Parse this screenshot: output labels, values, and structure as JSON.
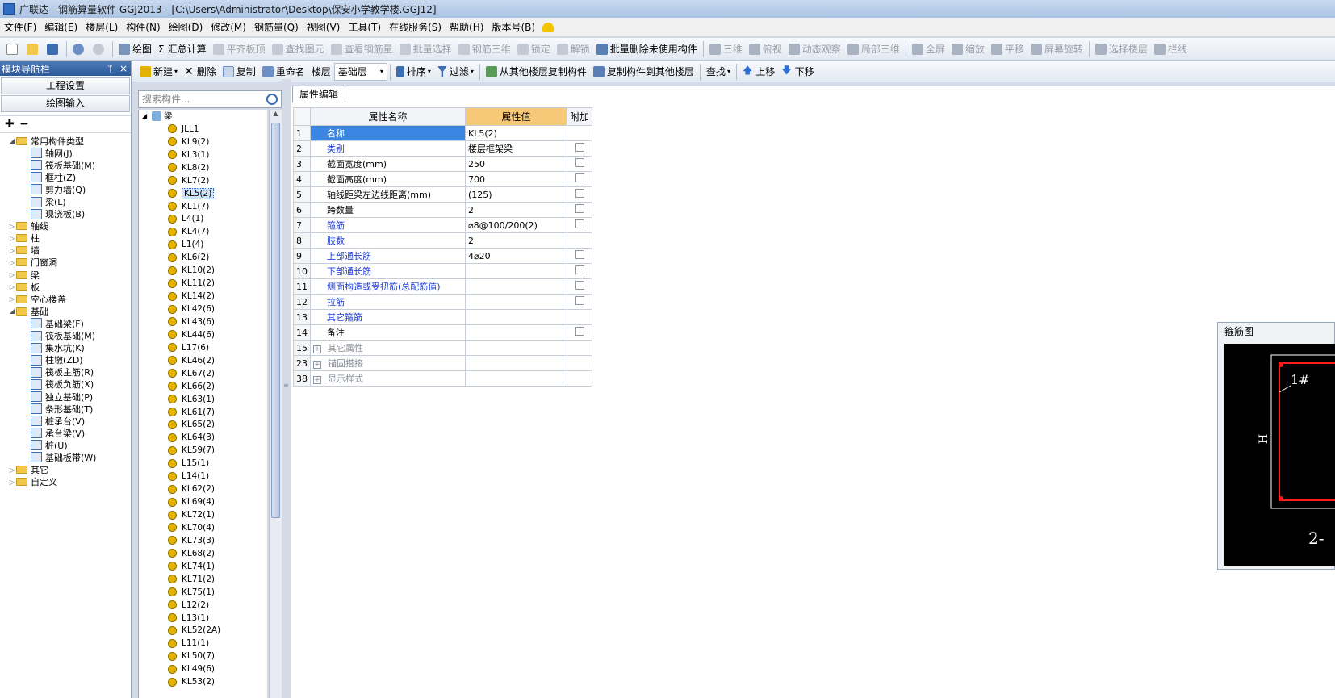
{
  "window": {
    "title": "广联达—钢筋算量软件 GGJ2013 - [C:\\Users\\Administrator\\Desktop\\保安小学教学楼.GGJ12]"
  },
  "menu": [
    "文件(F)",
    "编辑(E)",
    "楼层(L)",
    "构件(N)",
    "绘图(D)",
    "修改(M)",
    "钢筋量(Q)",
    "视图(V)",
    "工具(T)",
    "在线服务(S)",
    "帮助(H)",
    "版本号(B)"
  ],
  "toolbar1": {
    "draw": "绘图",
    "calc": "汇总计算",
    "align_top": "平齐板顶",
    "find_element": "查找图元",
    "view_rebar": "查看钢筋量",
    "batch_select": "批量选择",
    "rebar3d": "钢筋三维",
    "lock": "锁定",
    "unlock": "解锁",
    "batch_delete": "批量删除未使用构件",
    "view3d": "三维",
    "topview": "俯视",
    "dynamic": "动态观察",
    "local3d": "局部三维",
    "fullscreen": "全屏",
    "zoom": "缩放",
    "pan": "平移",
    "rotate": "屏幕旋转",
    "select_floor": "选择楼层",
    "other": "栏线"
  },
  "nav": {
    "title": "模块导航栏",
    "pin": "ᛘ",
    "close": "×",
    "btn_project": "工程设置",
    "btn_draw": "绘图输入"
  },
  "tree": [
    {
      "label": "常用构件类型",
      "level": 0,
      "type": "folder",
      "open": true
    },
    {
      "label": "轴网(J)",
      "level": 1,
      "type": "item"
    },
    {
      "label": "筏板基础(M)",
      "level": 1,
      "type": "item"
    },
    {
      "label": "框柱(Z)",
      "level": 1,
      "type": "item"
    },
    {
      "label": "剪力墙(Q)",
      "level": 1,
      "type": "item"
    },
    {
      "label": "梁(L)",
      "level": 1,
      "type": "item"
    },
    {
      "label": "现浇板(B)",
      "level": 1,
      "type": "item"
    },
    {
      "label": "轴线",
      "level": 0,
      "type": "folder"
    },
    {
      "label": "柱",
      "level": 0,
      "type": "folder"
    },
    {
      "label": "墙",
      "level": 0,
      "type": "folder"
    },
    {
      "label": "门窗洞",
      "level": 0,
      "type": "folder"
    },
    {
      "label": "梁",
      "level": 0,
      "type": "folder"
    },
    {
      "label": "板",
      "level": 0,
      "type": "folder"
    },
    {
      "label": "空心楼盖",
      "level": 0,
      "type": "folder"
    },
    {
      "label": "基础",
      "level": 0,
      "type": "folder",
      "open": true
    },
    {
      "label": "基础梁(F)",
      "level": 1,
      "type": "item"
    },
    {
      "label": "筏板基础(M)",
      "level": 1,
      "type": "item"
    },
    {
      "label": "集水坑(K)",
      "level": 1,
      "type": "item"
    },
    {
      "label": "柱墩(ZD)",
      "level": 1,
      "type": "item"
    },
    {
      "label": "筏板主筋(R)",
      "level": 1,
      "type": "item"
    },
    {
      "label": "筏板负筋(X)",
      "level": 1,
      "type": "item"
    },
    {
      "label": "独立基础(P)",
      "level": 1,
      "type": "item"
    },
    {
      "label": "条形基础(T)",
      "level": 1,
      "type": "item"
    },
    {
      "label": "桩承台(V)",
      "level": 1,
      "type": "item"
    },
    {
      "label": "承台梁(V)",
      "level": 1,
      "type": "item"
    },
    {
      "label": "桩(U)",
      "level": 1,
      "type": "item"
    },
    {
      "label": "基础板带(W)",
      "level": 1,
      "type": "item"
    },
    {
      "label": "其它",
      "level": 0,
      "type": "folder"
    },
    {
      "label": "自定义",
      "level": 0,
      "type": "folder"
    }
  ],
  "ctools": {
    "new": "新建",
    "delete": "删除",
    "copy": "复制",
    "rename": "重命名",
    "floor_label": "楼层",
    "floor_value": "基础层",
    "sort": "排序",
    "filter": "过滤",
    "copy_from": "从其他楼层复制构件",
    "copy_to": "复制构件到其他楼层",
    "find": "查找",
    "up": "上移",
    "down": "下移"
  },
  "search": {
    "placeholder": "搜索构件..."
  },
  "components": {
    "root": "梁",
    "selected": "KL5(2)",
    "items": [
      "JLL1",
      "KL9(2)",
      "KL3(1)",
      "KL8(2)",
      "KL7(2)",
      "KL5(2)",
      "KL1(7)",
      "L4(1)",
      "KL4(7)",
      "L1(4)",
      "KL6(2)",
      "KL10(2)",
      "KL11(2)",
      "KL14(2)",
      "KL42(6)",
      "KL43(6)",
      "KL44(6)",
      "L17(6)",
      "KL46(2)",
      "KL67(2)",
      "KL66(2)",
      "KL63(1)",
      "KL61(7)",
      "KL65(2)",
      "KL64(3)",
      "KL59(7)",
      "L15(1)",
      "L14(1)",
      "KL62(2)",
      "KL69(4)",
      "KL72(1)",
      "KL70(4)",
      "KL73(3)",
      "KL68(2)",
      "KL74(1)",
      "KL71(2)",
      "KL75(1)",
      "L12(2)",
      "L13(1)",
      "KL52(2A)",
      "L11(1)",
      "KL50(7)",
      "KL49(6)",
      "KL53(2)"
    ]
  },
  "editor": {
    "tab": "属性编辑",
    "col_name": "属性名称",
    "col_value": "属性值",
    "col_extra": "附加"
  },
  "props": [
    {
      "num": "1",
      "name": "名称",
      "value": "KL5(2)",
      "blue": true,
      "check": false,
      "selected": true
    },
    {
      "num": "2",
      "name": "类别",
      "value": "楼层框架梁",
      "blue": true,
      "check": true
    },
    {
      "num": "3",
      "name": "截面宽度(mm)",
      "value": "250",
      "blue": false,
      "check": true
    },
    {
      "num": "4",
      "name": "截面高度(mm)",
      "value": "700",
      "blue": false,
      "check": true
    },
    {
      "num": "5",
      "name": "轴线距梁左边线距离(mm)",
      "value": "(125)",
      "blue": false,
      "check": true
    },
    {
      "num": "6",
      "name": "跨数量",
      "value": "2",
      "blue": false,
      "check": true
    },
    {
      "num": "7",
      "name": "箍筋",
      "value": "⌀8@100/200(2)",
      "blue": true,
      "check": true
    },
    {
      "num": "8",
      "name": "肢数",
      "value": "2",
      "blue": true,
      "check": false
    },
    {
      "num": "9",
      "name": "上部通长筋",
      "value": "4⌀20",
      "blue": true,
      "check": true
    },
    {
      "num": "10",
      "name": "下部通长筋",
      "value": "",
      "blue": true,
      "check": true
    },
    {
      "num": "11",
      "name": "侧面构造或受扭筋(总配筋值)",
      "value": "",
      "blue": true,
      "check": true
    },
    {
      "num": "12",
      "name": "拉筋",
      "value": "",
      "blue": true,
      "check": true
    },
    {
      "num": "13",
      "name": "其它箍筋",
      "value": "",
      "blue": true,
      "check": false
    },
    {
      "num": "14",
      "name": "备注",
      "value": "",
      "blue": false,
      "check": true
    },
    {
      "num": "15",
      "name": "其它属性",
      "value": "",
      "group": true
    },
    {
      "num": "23",
      "name": "锚固搭接",
      "value": "",
      "group": true
    },
    {
      "num": "38",
      "name": "显示样式",
      "value": "",
      "group": true
    }
  ],
  "stirrup": {
    "title": "箍筋图",
    "label_1": "1#",
    "label_h": "H",
    "label_bottom": "2-"
  }
}
